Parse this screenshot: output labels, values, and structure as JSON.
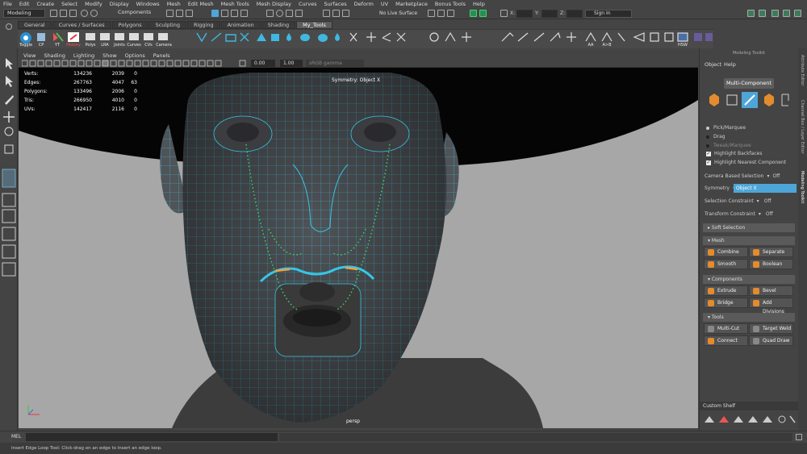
{
  "menu": [
    "File",
    "Edit",
    "Create",
    "Select",
    "Modify",
    "Display",
    "Windows",
    "Mesh",
    "Edit Mesh",
    "Mesh Tools",
    "Mesh Display",
    "Curves",
    "Surfaces",
    "Deform",
    "UV",
    "Marketplace",
    "Bonus Tools",
    "Help"
  ],
  "status": {
    "workspace": "Modeling",
    "selection_mode": "Components",
    "live_surface": "No Live Surface",
    "x_label": "X:",
    "y_label": "Y:",
    "z_label": "Z:",
    "sign_in": "Sign In"
  },
  "shelf_tabs": [
    {
      "label": "General",
      "active": false
    },
    {
      "label": "Curves / Surfaces",
      "active": false
    },
    {
      "label": "Polygons",
      "active": false
    },
    {
      "label": "Sculpting",
      "active": false
    },
    {
      "label": "Rigging",
      "active": false
    },
    {
      "label": "Animation",
      "active": false
    },
    {
      "label": "Shading",
      "active": false
    },
    {
      "label": "My_Tools",
      "active": true
    }
  ],
  "shelf_labels": [
    "Toggle",
    "CP",
    "YT",
    "History",
    "Polys",
    "LRA",
    "Joints",
    "Curves",
    "CVs",
    "Camera"
  ],
  "shelf_extra_labels": [
    "AA",
    "A>B",
    "HSW"
  ],
  "viewport": {
    "menu": [
      "View",
      "Shading",
      "Lighting",
      "Show",
      "Options",
      "Panels"
    ],
    "exposure": "0.00",
    "gamma": "1.00",
    "color_space": "sRGB gamma",
    "symmetry_label": "Symmetry: Object X",
    "camera_label": "persp",
    "hud": [
      {
        "label": "Verts:",
        "v1": "134236",
        "v2": "2039",
        "v3": "0"
      },
      {
        "label": "Edges:",
        "v1": "267763",
        "v2": "4047",
        "v3": "63"
      },
      {
        "label": "Polygons:",
        "v1": "133496",
        "v2": "2006",
        "v3": "0"
      },
      {
        "label": "Tris:",
        "v1": "266950",
        "v2": "4010",
        "v3": "0"
      },
      {
        "label": "UVs:",
        "v1": "142417",
        "v2": "2116",
        "v3": "0"
      }
    ]
  },
  "toolkit": {
    "title": "Modeling Toolkit",
    "menu_object": "Object",
    "menu_help": "Help",
    "multi_component": "Multi-Component",
    "pick_marquee": "Pick/Marquee",
    "drag": "Drag",
    "tweak_marquee": "Tweak/Marquee",
    "highlight_backfaces": "Highlight Backfaces",
    "highlight_nearest": "Highlight Nearest Component",
    "camera_based_selection": "Camera Based Selection",
    "camera_based_value": "Off",
    "symmetry": "Symmetry",
    "symmetry_value": "Object X",
    "selection_constraint": "Selection Constraint",
    "selection_constraint_value": "Off",
    "transform_constraint": "Transform Constraint",
    "transform_constraint_value": "Off",
    "soft_selection": "Soft Selection",
    "section_mesh": "Mesh",
    "combine": "Combine",
    "separate": "Separate",
    "smooth": "Smooth",
    "boolean": "Boolean",
    "section_components": "Components",
    "extrude": "Extrude",
    "bevel": "Bevel",
    "bridge": "Bridge",
    "add_divisions": "Add Divisions",
    "section_tools": "Tools",
    "multi_cut": "Multi-Cut",
    "target_weld": "Target Weld",
    "connect": "Connect",
    "quad_draw": "Quad Draw",
    "custom_shelf": "Custom Shelf"
  },
  "side_tabs": [
    "Attribute Editor",
    "Channel Box / Layer Editor",
    "Modeling Toolkit"
  ],
  "mel_label": "MEL",
  "help_line": "Insert Edge Loop Tool: Click-drag on an edge to insert an edge loop.",
  "colors": {
    "wire": "#36c6e8",
    "sym": "#3fd66a",
    "loop": "#f0a040",
    "accent": "#4ea6d8"
  }
}
